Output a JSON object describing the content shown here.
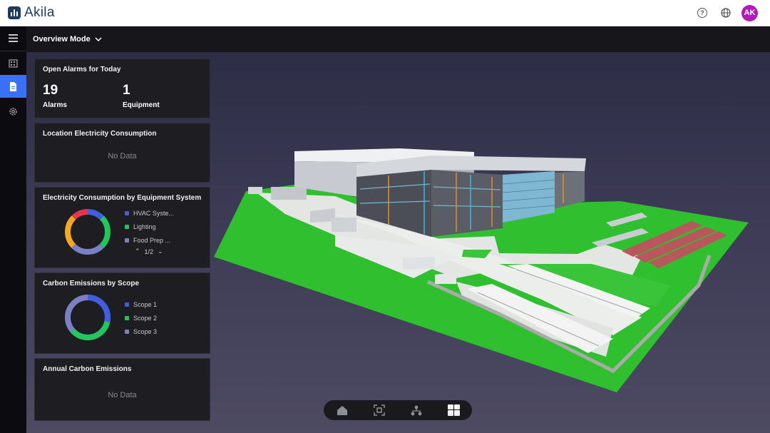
{
  "app": {
    "name": "Akila",
    "avatar_initials": "AK",
    "avatar_color": "#b01ab8"
  },
  "header": {
    "icons": [
      "help-icon",
      "globe-icon"
    ]
  },
  "sidebar": {
    "items": [
      {
        "name": "menu-icon"
      },
      {
        "name": "building-icon"
      },
      {
        "name": "document-icon",
        "active": true
      },
      {
        "name": "gear-icon"
      }
    ]
  },
  "mode": {
    "label": "Overview Mode"
  },
  "alarms": {
    "title": "Open Alarms for Today",
    "alarms_count": "19",
    "alarms_label": "Alarms",
    "equipment_count": "1",
    "equipment_label": "Equipment"
  },
  "location_electricity": {
    "title": "Location Electricity Consumption",
    "empty_text": "No Data"
  },
  "electricity_by_system": {
    "title": "Electricity Consumption by Equipment System",
    "legend": [
      {
        "label": "HVAC Syste...",
        "color": "#3f5fe0"
      },
      {
        "label": "Lighting",
        "color": "#22c55e"
      },
      {
        "label": "Food Prep ...",
        "color": "#7b7fc4"
      }
    ],
    "page": "1/2"
  },
  "carbon_by_scope": {
    "title": "Carbon Emissions by Scope",
    "legend": [
      {
        "label": "Scope 1",
        "color": "#3f5fe0"
      },
      {
        "label": "Scope 2",
        "color": "#22c55e"
      },
      {
        "label": "Scope 3",
        "color": "#7b7fc4"
      }
    ]
  },
  "annual_carbon": {
    "title": "Annual Carbon Emissions",
    "empty_text": "No Data"
  },
  "view_toolbar": {
    "buttons": [
      "home-icon",
      "focus-icon",
      "hierarchy-icon",
      "layout-icon"
    ],
    "active_index": 3
  },
  "colors": {
    "accent": "#3a6ff7",
    "panel": "#1d1d22",
    "grass": "#2fbf2f"
  }
}
